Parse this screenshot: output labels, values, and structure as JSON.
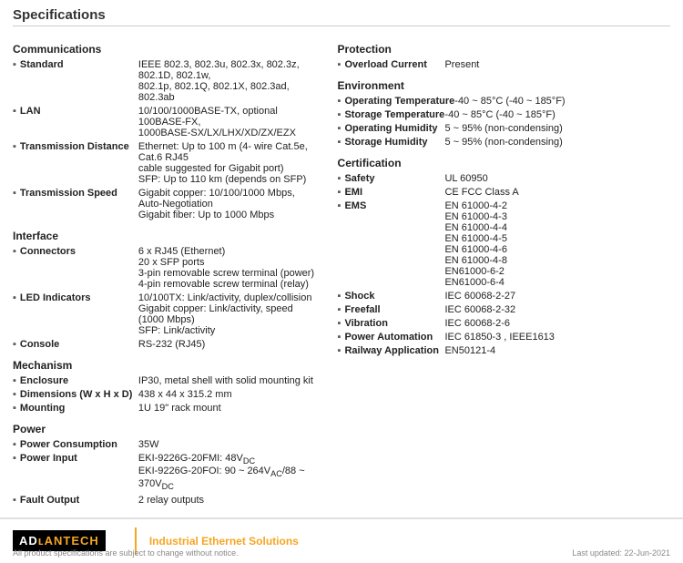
{
  "page": {
    "title": "Specifications"
  },
  "left": {
    "sections": [
      {
        "id": "communications",
        "title": "Communications",
        "items": [
          {
            "label": "Standard",
            "value": "IEEE 802.3, 802.3u, 802.3x, 802.3z, 802.1D, 802.1w,\n802.1p, 802.1Q, 802.1X, 802.3ad, 802.3ab"
          },
          {
            "label": "LAN",
            "value": "10/100/1000BASE-TX, optional 100BASE-FX,\n1000BASE-SX/LX/LHX/XD/ZX/EZX"
          },
          {
            "label": "Transmission Distance",
            "value": "Ethernet: Up to 100 m (4- wire Cat.5e, Cat.6 RJ45\ncable suggested for Gigabit port)\nSFP: Up to 110 km (depends on SFP)"
          },
          {
            "label": "Transmission Speed",
            "value": "Gigabit copper: 10/100/1000 Mbps, Auto-Negotiation\nGigabit fiber: Up to 1000 Mbps"
          }
        ]
      },
      {
        "id": "interface",
        "title": "Interface",
        "items": [
          {
            "label": "Connectors",
            "value": "6 x RJ45 (Ethernet)\n20 x SFP ports\n3-pin removable screw terminal (power)\n4-pin removable screw terminal (relay)"
          },
          {
            "label": "LED Indicators",
            "value": "10/100TX: Link/activity, duplex/collision\nGigabit copper: Link/activity, speed (1000 Mbps)\nSFP: Link/activity"
          },
          {
            "label": "Console",
            "value": "RS-232 (RJ45)"
          }
        ]
      },
      {
        "id": "mechanism",
        "title": "Mechanism",
        "items": [
          {
            "label": "Enclosure",
            "value": "IP30, metal shell with solid mounting kit"
          },
          {
            "label": "Dimensions (W x H x D)",
            "value": "438 x 44 x 315.2 mm"
          },
          {
            "label": "Mounting",
            "value": "1U 19\" rack mount"
          }
        ]
      },
      {
        "id": "power",
        "title": "Power",
        "items": [
          {
            "label": "Power Consumption",
            "value": "35W"
          },
          {
            "label": "Power Input",
            "value": "EKI-9226G-20FMI: 48VDC\nEKI-9226G-20FOI: 90 ~ 264VAC/88 ~ 370VDC"
          },
          {
            "label": "Fault Output",
            "value": "2 relay outputs"
          }
        ]
      }
    ]
  },
  "right": {
    "sections": [
      {
        "id": "protection",
        "title": "Protection",
        "items": [
          {
            "label": "Overload Current",
            "value": "Present"
          }
        ]
      },
      {
        "id": "environment",
        "title": "Environment",
        "items": [
          {
            "label": "Operating Temperature",
            "value": "-40 ~ 85°C (-40 ~ 185°F)"
          },
          {
            "label": "Storage Temperature",
            "value": "-40 ~ 85°C (-40 ~ 185°F)"
          },
          {
            "label": "Operating Humidity",
            "value": "5 ~ 95% (non-condensing)"
          },
          {
            "label": "Storage Humidity",
            "value": "5 ~ 95% (non-condensing)"
          }
        ]
      },
      {
        "id": "certification",
        "title": "Certification",
        "items": [
          {
            "label": "Safety",
            "value": "UL 60950"
          },
          {
            "label": "EMI",
            "value": "CE FCC Class A"
          },
          {
            "label": "EMS",
            "value": "EN 61000-4-2\nEN 61000-4-3\nEN 61000-4-4\nEN 61000-4-5\nEN 61000-4-6\nEN 61000-4-8\nEN61000-6-2\nEN61000-6-4"
          },
          {
            "label": "Shock",
            "value": "IEC 60068-2-27"
          },
          {
            "label": "Freefall",
            "value": "IEC 60068-2-32"
          },
          {
            "label": "Vibration",
            "value": "IEC 60068-2-6"
          },
          {
            "label": "Power Automation",
            "value": "IEC 61850-3 , IEEE1613"
          },
          {
            "label": "Railway Application",
            "value": "EN50121-4"
          }
        ]
      }
    ]
  },
  "footer": {
    "logo_brand": "ADʟANTECH",
    "logo_ad": "AD",
    "logo_vantech": "VANTECH",
    "tagline": "Industrial Ethernet Solutions",
    "note": "All product specifications are subject to change without notice.",
    "date": "Last updated: 22-Jun-2021"
  }
}
